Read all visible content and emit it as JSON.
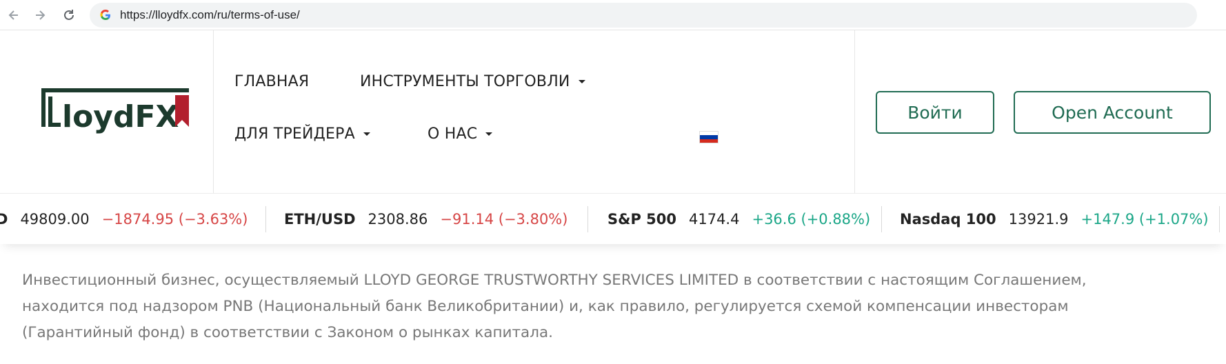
{
  "browser": {
    "url": "https://lloydfx.com/ru/terms-of-use/"
  },
  "logo": {
    "text": "LloydFX",
    "brand_color": "#1c3a2d",
    "accent_color": "#b21f2d"
  },
  "nav": {
    "items": [
      {
        "label": "ГЛАВНАЯ"
      },
      {
        "label": "ИНСТРУМЕНТЫ ТОРГОВЛИ"
      },
      {
        "label": "ДЛЯ ТРЕЙДЕРА"
      },
      {
        "label": "О НАС"
      }
    ],
    "language_flag": "ru-flag-icon"
  },
  "actions": {
    "login_label": "Войти",
    "open_account_label": "Open Account",
    "accent_color": "#1f6b52"
  },
  "ticker": [
    {
      "symbol": "D",
      "price": "49809.00",
      "change": "−1874.95 (−3.63%)",
      "direction": "down"
    },
    {
      "symbol": "ETH/USD",
      "price": "2308.86",
      "change": "−91.14 (−3.80%)",
      "direction": "down"
    },
    {
      "symbol": "S&P 500",
      "price": "4174.4",
      "change": "+36.6 (+0.88%)",
      "direction": "up"
    },
    {
      "symbol": "Nasdaq 100",
      "price": "13921.9",
      "change": "+147.9 (+1.07%)",
      "direction": "up"
    }
  ],
  "content": {
    "line1": "Инвестиционный бизнес, осуществляемый LLOYD GEORGE TRUSTWORTHY SERVICES LIMITED в соответствии с настоящим Соглашением,",
    "line2": "находится под надзором PNB (Национальный банк Великобритании) и, как правило, регулируется схемой компенсации инвесторам",
    "line3": "(Гарантийный фонд) в соответствии с Законом о рынках капитала."
  }
}
